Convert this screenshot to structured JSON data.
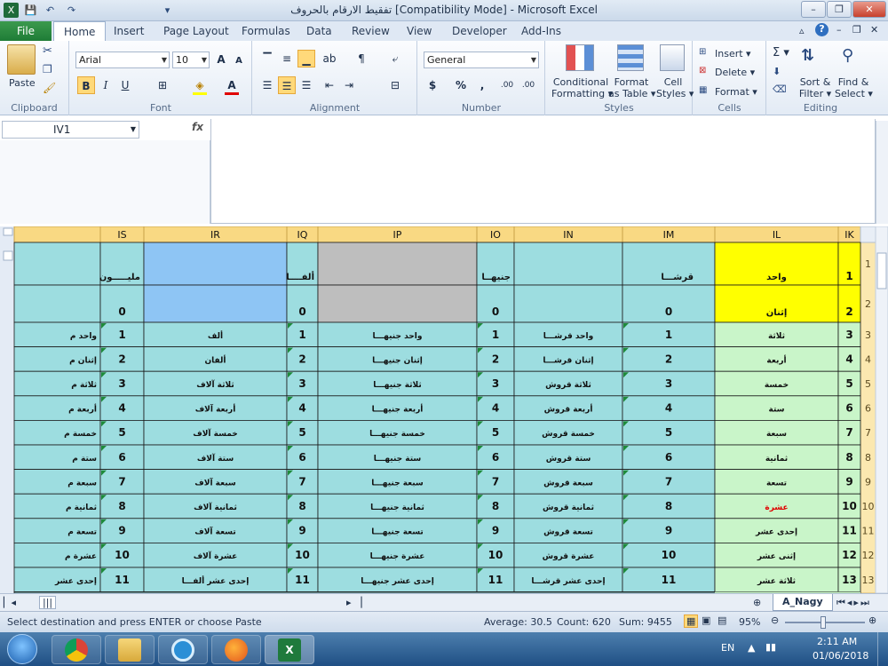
{
  "window": {
    "title": "تفقيط الارقام بالحروف  [Compatibility Mode]  -  Microsoft Excel",
    "minimize": "–",
    "restore": "❐",
    "close": "✕"
  },
  "quick_access": [
    "💾",
    "↶",
    "↷",
    "▾"
  ],
  "tabs": {
    "file": "File",
    "items": [
      "Home",
      "Insert",
      "Page Layout",
      "Formulas",
      "Data",
      "Review",
      "View",
      "Developer",
      "Add-Ins"
    ]
  },
  "ribbon": {
    "clipboard": {
      "label": "Clipboard",
      "paste": "Paste"
    },
    "font": {
      "label": "Font",
      "family": "Arial",
      "size": "10",
      "bold": "B",
      "italic": "I",
      "underline": "U",
      "grow": "A",
      "shrink": "A"
    },
    "alignment": {
      "label": "Alignment"
    },
    "number": {
      "label": "Number",
      "format": "General",
      "currency": "$",
      "percent": "%",
      "comma": ",",
      "inc_decimal": ".00",
      "dec_decimal": ".00"
    },
    "styles": {
      "label": "Styles",
      "conditional": [
        "Conditional",
        "Formatting ▾"
      ],
      "format_table": [
        "Format",
        "as Table ▾"
      ],
      "cell_styles": [
        "Cell",
        "Styles ▾"
      ]
    },
    "cells": {
      "label": "Cells",
      "insert": "Insert ▾",
      "delete": "Delete ▾",
      "format": "Format ▾"
    },
    "editing": {
      "label": "Editing",
      "sum": "Σ ▾",
      "sort": [
        "Sort &",
        "Filter ▾"
      ],
      "find": [
        "Find &",
        "Select ▾"
      ]
    }
  },
  "formula_bar": {
    "name_box": "IV1",
    "fx": "fx",
    "value": ""
  },
  "grid": {
    "columns": [
      "IS",
      "IR",
      "IQ",
      "IP",
      "IO",
      "IN",
      "IM",
      "IL",
      "IK"
    ],
    "row_numbers": [
      "1",
      "2",
      "3",
      "4",
      "5",
      "6",
      "7",
      "8",
      "9",
      "10",
      "11",
      "12",
      "13"
    ],
    "row1": {
      "IS": "مليـــــون",
      "IQ": "ألفــــا",
      "IO": "جنيهــا",
      "IM": "قرشـــا",
      "IL": "واحد",
      "IK": "1"
    },
    "row2": {
      "IS": "0",
      "IQ": "0",
      "IO": "0",
      "IM": "0",
      "IL": "إثنان",
      "IK": "2"
    },
    "data_rows": [
      {
        "n": "1",
        "IR": "ألف",
        "IP": "واحد جنيهـــا",
        "IN": "واحد قرشـــا",
        "IL": "ثلاثة",
        "IK": "3",
        "edge": "واحد م"
      },
      {
        "n": "2",
        "IR": "ألفان",
        "IP": "إثنان جنيهـــا",
        "IN": "إثنان قرشـــا",
        "IL": "أربعة",
        "IK": "4",
        "edge": "إثنان م"
      },
      {
        "n": "3",
        "IR": "ثلاثة آلاف",
        "IP": "ثلاثة جنيهـــا",
        "IN": "ثلاثة قروش",
        "IL": "خمسة",
        "IK": "5",
        "edge": "ثلاثة م"
      },
      {
        "n": "4",
        "IR": "أربعة آلاف",
        "IP": "أربعة جنيهـــا",
        "IN": "أربعة قروش",
        "IL": "ستة",
        "IK": "6",
        "edge": "أربعة م"
      },
      {
        "n": "5",
        "IR": "خمسة آلاف",
        "IP": "خمسة جنيهـــا",
        "IN": "خمسة قروش",
        "IL": "سبعة",
        "IK": "7",
        "edge": "خمسة م"
      },
      {
        "n": "6",
        "IR": "ستة آلاف",
        "IP": "ستة جنيهـــا",
        "IN": "ستة قروش",
        "IL": "ثمانية",
        "IK": "8",
        "edge": "ستة م"
      },
      {
        "n": "7",
        "IR": "سبعة آلاف",
        "IP": "سبعة جنيهـــا",
        "IN": "سبعة قروش",
        "IL": "تسعة",
        "IK": "9",
        "edge": "سبعة م"
      },
      {
        "n": "8",
        "IR": "ثمانية آلاف",
        "IP": "ثمانية جنيهـــا",
        "IN": "ثمانية قروش",
        "IL": "عشرة",
        "IK": "10",
        "edge": "ثمانية م"
      },
      {
        "n": "9",
        "IR": "تسعة آلاف",
        "IP": "تسعة جنيهـــا",
        "IN": "تسعة قروش",
        "IL": "إحدى عشر",
        "IK": "11",
        "edge": "تسعة م"
      },
      {
        "n": "10",
        "IR": "عشرة آلاف",
        "IP": "عشرة جنيهـــا",
        "IN": "عشرة قروش",
        "IL": "إثنى عشر",
        "IK": "12",
        "edge": "عشرة م"
      },
      {
        "n": "11",
        "IR": "إحدى عشر ألفـــا",
        "IP": "إحدى عشر جنيهـــا",
        "IN": "إحدى عشر قرشـــا",
        "IL": "ثلاثة عشر",
        "IK": "13",
        "edge": "إحدى عشر"
      }
    ],
    "colors": {
      "header": "#f9d983",
      "cyan": "#9ddde0",
      "blue": "#8ec5f4",
      "gray": "#bebebe",
      "yellow": "#ffff00",
      "green": "#c9f5c9",
      "red_text": "#e00000"
    }
  },
  "sheet_tab": "A_Nagy",
  "status": {
    "message": "Select destination and press ENTER or choose Paste",
    "average": "Average: 30.5",
    "count": "Count: 620",
    "sum": "Sum: 9455",
    "zoom": "95%"
  },
  "taskbar": {
    "lang": "EN",
    "time": "2:11 AM",
    "date": "01/06/2018"
  }
}
